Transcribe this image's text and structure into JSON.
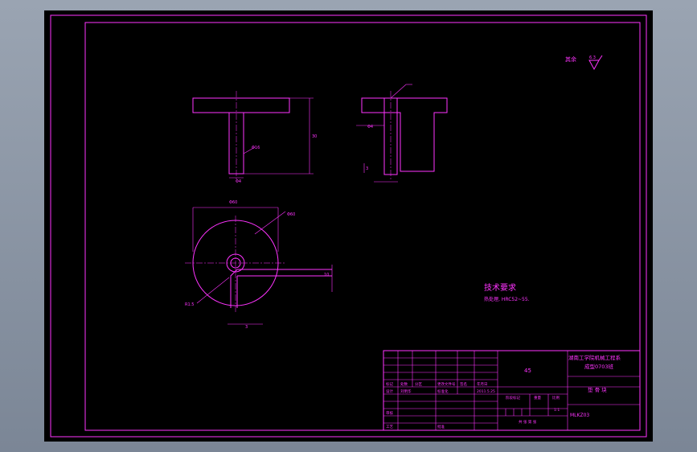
{
  "surface_finish": {
    "label": "其余",
    "value": "6.3"
  },
  "part": {
    "dim_outer_diameter": "Φ60",
    "dim_height": "30",
    "dim_bore": "Φ16",
    "dim_small_hole": "Φ4",
    "dim_chamfer": "R1.5",
    "dim_offset_1": "3",
    "dim_offset_2": "10"
  },
  "tech_requirements": {
    "title": "技术要求",
    "line1": "热处理, HRC52~55."
  },
  "title_block": {
    "material": "45",
    "school_line1": "湖南工学院机械工程系",
    "school_line2": "成型0703班",
    "part_name": "垫 骨 块",
    "drawing_no": "MLKZ03",
    "scale": "1:1",
    "sheet": "共 张 第 张",
    "header_labels": [
      "标记",
      "处数",
      "分区",
      "更改文件号",
      "签名",
      "年月日"
    ],
    "row_labels": [
      "设计",
      "标准化",
      "审核",
      "工艺",
      "批准"
    ],
    "designer": "刘明华",
    "stage_labels": [
      "阶段标记",
      "重量",
      "比例"
    ],
    "date": "2011.5.25"
  }
}
